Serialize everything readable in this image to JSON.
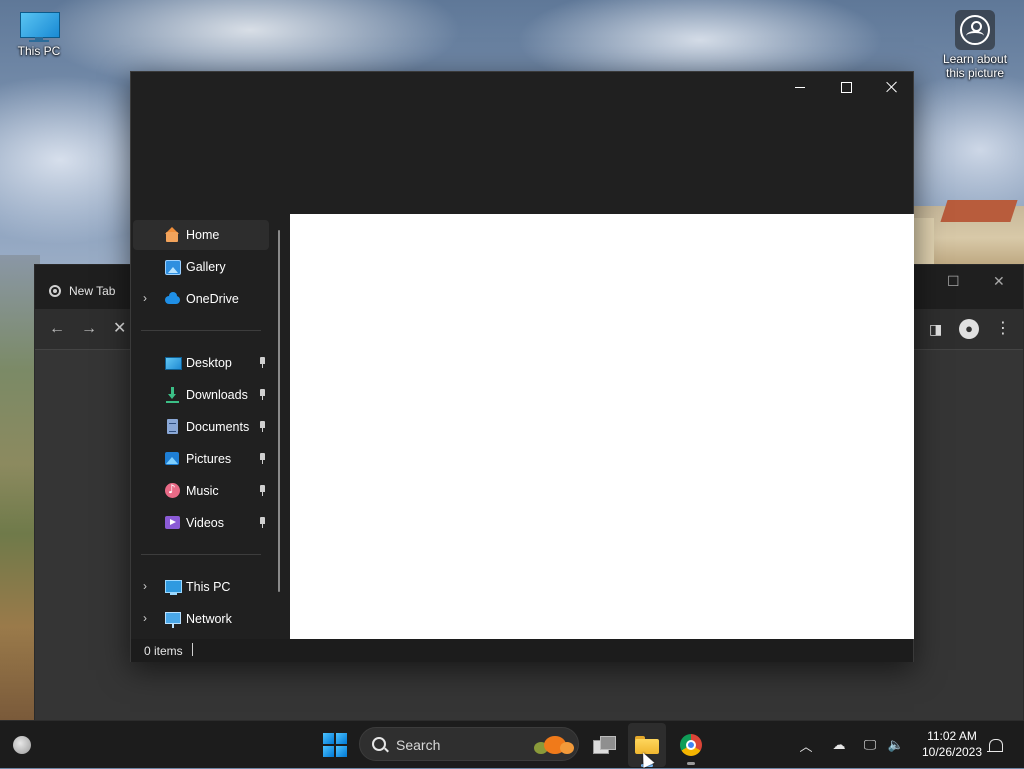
{
  "desktop": {
    "icons": [
      {
        "label": "This PC"
      },
      {
        "label": "Learn about\nthis picture"
      }
    ]
  },
  "chrome_window": {
    "tab_title": "New Tab"
  },
  "explorer": {
    "nav": {
      "items": [
        {
          "label": "Home",
          "icon": "home-icon",
          "selected": true
        },
        {
          "label": "Gallery",
          "icon": "gallery-icon"
        },
        {
          "label": "OneDrive",
          "icon": "onedrive-icon",
          "expandable": true
        },
        {
          "label": "Desktop",
          "icon": "desktop-icon",
          "pinned": true
        },
        {
          "label": "Downloads",
          "icon": "downloads-icon",
          "pinned": true
        },
        {
          "label": "Documents",
          "icon": "documents-icon",
          "pinned": true
        },
        {
          "label": "Pictures",
          "icon": "pictures-icon",
          "pinned": true
        },
        {
          "label": "Music",
          "icon": "music-icon",
          "pinned": true
        },
        {
          "label": "Videos",
          "icon": "videos-icon",
          "pinned": true
        },
        {
          "label": "This PC",
          "icon": "this-pc-icon",
          "expandable": true
        },
        {
          "label": "Network",
          "icon": "network-icon",
          "expandable": true
        }
      ]
    },
    "status": {
      "items_text": "0 items"
    }
  },
  "taskbar": {
    "search_placeholder": "Search",
    "clock_time": "11:02 AM",
    "clock_date": "10/26/2023"
  },
  "colors": {
    "accent": "#0078d4",
    "explorer_bg": "#202020",
    "taskbar_bg": "#1c1c1c"
  }
}
